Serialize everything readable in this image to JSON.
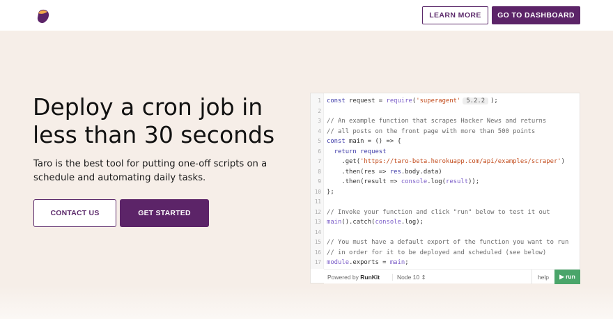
{
  "nav": {
    "learn_more": "LEARN MORE",
    "dashboard": "GO TO DASHBOARD"
  },
  "hero": {
    "title": "Deploy a cron job in less than 30 seconds",
    "subtitle": "Taro is the best tool for putting one-off scripts on a schedule and automating daily tasks.",
    "contact": "CONTACT US",
    "get_started": "GET STARTED"
  },
  "editor": {
    "version_badge": "5.2.2",
    "lines": [
      "const request = require('superagent'",
      "",
      "// An example function that scrapes Hacker News and returns",
      "// all posts on the front page with more than 500 points",
      "const main = () => {",
      "  return request",
      "    .get('https://taro-beta.herokuapp.com/api/examples/scraper')",
      "    .then(res => res.body.data)",
      "    .then(result => console.log(result));",
      "};",
      "",
      "// Invoke your function and click \"run\" below to test it out",
      "main().catch(console.log);",
      "",
      "// You must have a default export of the function you want to run",
      "// in order for it to be deployed and scheduled (see below)",
      "module.exports = main;"
    ],
    "line_1_tail": ");",
    "powered_by": "Powered by",
    "runkit": "RunKit",
    "node_version": "Node 10 ⇕",
    "help": "help",
    "run": "▶ run"
  },
  "colors": {
    "brand_purple": "#5c2468",
    "page_bg": "#f6eee8",
    "run_green": "#4aa56a"
  }
}
